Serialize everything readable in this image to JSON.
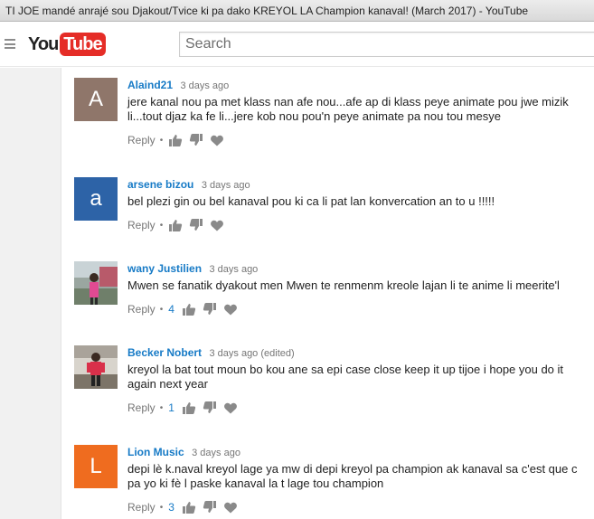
{
  "window": {
    "title": "TI JOE mandé anrajé sou Djakout/Tvice ki pa dako KREYOL LA Champion kanaval! (March 2017) - YouTube"
  },
  "masthead": {
    "logo_you": "You",
    "logo_tube": "Tube",
    "search_placeholder": "Search"
  },
  "colors": {
    "author_link": "#167ac6",
    "youtube_red": "#e52d27"
  },
  "comments": [
    {
      "author": "Alaind21",
      "time": "3 days ago",
      "avatar_letter": "A",
      "avatar_color": "#8f766a",
      "text": "jere kanal nou pa met klass nan afe nou...afe ap di klass peye animate pou jwe mizik li...tout djaz ka fe li...jere kob nou pou'n peye animate pa nou tou mesye",
      "reply": "Reply",
      "likes": ""
    },
    {
      "author": "arsene bizou",
      "time": "3 days ago",
      "avatar_letter": "a",
      "avatar_color": "#2d63a7",
      "text": "bel plezi gin ou bel kanaval pou ki ca li pat lan konvercation an to u !!!!!",
      "reply": "Reply",
      "likes": ""
    },
    {
      "author": "wany Justilien",
      "time": "3 days ago",
      "avatar_letter": "",
      "avatar_color": "",
      "text": "Mwen se fanatik dyakout  men Mwen te renmenm kreole lajan li te anime li meerite'l",
      "reply": "Reply",
      "likes": "4"
    },
    {
      "author": "Becker Nobert",
      "time": "3 days ago (edited)",
      "avatar_letter": "",
      "avatar_color": "",
      "text": "kreyol la bat tout moun bo kou ane sa epi case close keep it up tijoe i hope you do it again next year",
      "reply": "Reply",
      "likes": "1"
    },
    {
      "author": "Lion Music",
      "time": "3 days ago",
      "avatar_letter": "L",
      "avatar_color": "#ef6c1f",
      "text": "depi lè k.naval kreyol lage ya mw di depi kreyol pa champion ak kanaval sa c'est que c pa yo ki fè l paske kanaval la t lage tou champion",
      "reply": "Reply",
      "likes": "3"
    }
  ]
}
